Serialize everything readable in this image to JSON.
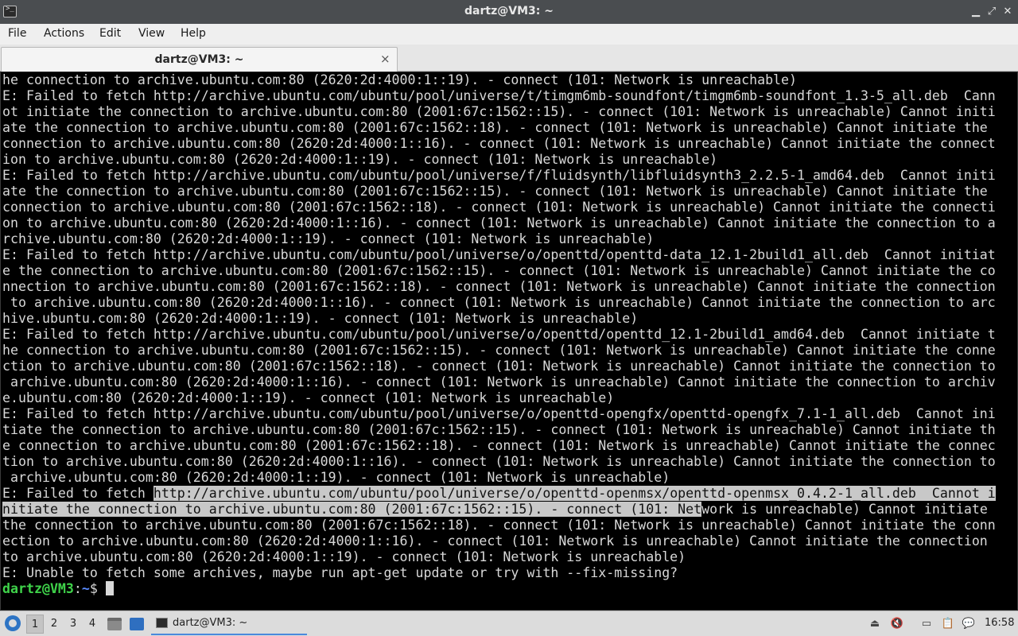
{
  "window": {
    "title": "dartz@VM3: ~",
    "controls": {
      "minimize": "▁",
      "maximize": "⤢",
      "close": "✕"
    }
  },
  "menu": {
    "items": [
      "File",
      "Actions",
      "Edit",
      "View",
      "Help"
    ]
  },
  "tab": {
    "label": "dartz@VM3: ~",
    "close": "×"
  },
  "terminal": {
    "colors": {
      "background": "#000000",
      "text": "#d8d8d8",
      "prompt_user": "#3fd34a",
      "prompt_path": "#5a8bff",
      "selection": "#c8c8c8"
    },
    "lines": [
      "he connection to archive.ubuntu.com:80 (2620:2d:4000:1::19). - connect (101: Network is unreachable)",
      "E: Failed to fetch http://archive.ubuntu.com/ubuntu/pool/universe/t/timgm6mb-soundfont/timgm6mb-soundfont_1.3-5_all.deb  Cann",
      "ot initiate the connection to archive.ubuntu.com:80 (2001:67c:1562::15). - connect (101: Network is unreachable) Cannot initi",
      "ate the connection to archive.ubuntu.com:80 (2001:67c:1562::18). - connect (101: Network is unreachable) Cannot initiate the",
      "connection to archive.ubuntu.com:80 (2620:2d:4000:1::16). - connect (101: Network is unreachable) Cannot initiate the connect",
      "ion to archive.ubuntu.com:80 (2620:2d:4000:1::19). - connect (101: Network is unreachable)",
      "E: Failed to fetch http://archive.ubuntu.com/ubuntu/pool/universe/f/fluidsynth/libfluidsynth3_2.2.5-1_amd64.deb  Cannot initi",
      "ate the connection to archive.ubuntu.com:80 (2001:67c:1562::15). - connect (101: Network is unreachable) Cannot initiate the",
      "connection to archive.ubuntu.com:80 (2001:67c:1562::18). - connect (101: Network is unreachable) Cannot initiate the connecti",
      "on to archive.ubuntu.com:80 (2620:2d:4000:1::16). - connect (101: Network is unreachable) Cannot initiate the connection to a",
      "rchive.ubuntu.com:80 (2620:2d:4000:1::19). - connect (101: Network is unreachable)",
      "E: Failed to fetch http://archive.ubuntu.com/ubuntu/pool/universe/o/openttd/openttd-data_12.1-2build1_all.deb  Cannot initiat",
      "e the connection to archive.ubuntu.com:80 (2001:67c:1562::15). - connect (101: Network is unreachable) Cannot initiate the co",
      "nnection to archive.ubuntu.com:80 (2001:67c:1562::18). - connect (101: Network is unreachable) Cannot initiate the connection",
      " to archive.ubuntu.com:80 (2620:2d:4000:1::16). - connect (101: Network is unreachable) Cannot initiate the connection to arc",
      "hive.ubuntu.com:80 (2620:2d:4000:1::19). - connect (101: Network is unreachable)",
      "E: Failed to fetch http://archive.ubuntu.com/ubuntu/pool/universe/o/openttd/openttd_12.1-2build1_amd64.deb  Cannot initiate t",
      "he connection to archive.ubuntu.com:80 (2001:67c:1562::15). - connect (101: Network is unreachable) Cannot initiate the conne",
      "ction to archive.ubuntu.com:80 (2001:67c:1562::18). - connect (101: Network is unreachable) Cannot initiate the connection to",
      " archive.ubuntu.com:80 (2620:2d:4000:1::16). - connect (101: Network is unreachable) Cannot initiate the connection to archiv",
      "e.ubuntu.com:80 (2620:2d:4000:1::19). - connect (101: Network is unreachable)",
      "E: Failed to fetch http://archive.ubuntu.com/ubuntu/pool/universe/o/openttd-opengfx/openttd-opengfx_7.1-1_all.deb  Cannot ini",
      "tiate the connection to archive.ubuntu.com:80 (2001:67c:1562::15). - connect (101: Network is unreachable) Cannot initiate th",
      "e connection to archive.ubuntu.com:80 (2001:67c:1562::18). - connect (101: Network is unreachable) Cannot initiate the connec",
      "tion to archive.ubuntu.com:80 (2620:2d:4000:1::16). - connect (101: Network is unreachable) Cannot initiate the connection to",
      " archive.ubuntu.com:80 (2620:2d:4000:1::19). - connect (101: Network is unreachable)"
    ],
    "selected_line_1": {
      "before": "E: Failed to fetch ",
      "selected": "http://archive.ubuntu.com/ubuntu/pool/universe/o/openttd-openmsx/openttd-openmsx_0.4.2-1_all.deb  Cannot i"
    },
    "selected_line_2": {
      "selected": "nitiate the connection to archive.ubuntu.com:80 (2001:67c:1562::15). - connect (101: Net",
      "after": "work is unreachable) Cannot initiate"
    },
    "tail_lines": [
      "the connection to archive.ubuntu.com:80 (2001:67c:1562::18). - connect (101: Network is unreachable) Cannot initiate the conn",
      "ection to archive.ubuntu.com:80 (2620:2d:4000:1::16). - connect (101: Network is unreachable) Cannot initiate the connection",
      "to archive.ubuntu.com:80 (2620:2d:4000:1::19). - connect (101: Network is unreachable)",
      "E: Unable to fetch some archives, maybe run apt-get update or try with --fix-missing?"
    ],
    "prompt": {
      "user_host": "dartz@VM3",
      "separator": ":",
      "path": "~",
      "symbol": "$ "
    }
  },
  "taskbar": {
    "workspaces": [
      "1",
      "2",
      "3",
      "4"
    ],
    "active_workspace": "1",
    "task_label": "dartz@VM3: ~",
    "clock": "16:58",
    "accent": "#4a89dc"
  }
}
